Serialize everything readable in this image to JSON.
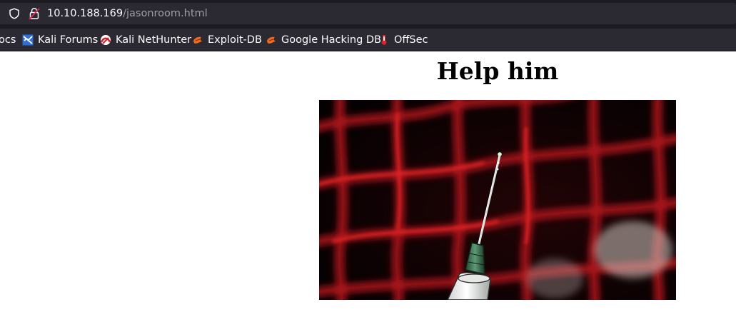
{
  "browser": {
    "url_host": "10.10.188.169",
    "url_path": "/jasonroom.html"
  },
  "bookmarks": [
    {
      "label": "ocs",
      "icon": "kali-docs-icon"
    },
    {
      "label": "Kali Forums",
      "icon": "kali-forums-icon"
    },
    {
      "label": "Kali NetHunter",
      "icon": "kali-nethunter-icon"
    },
    {
      "label": "Exploit-DB",
      "icon": "exploit-db-icon"
    },
    {
      "label": "Google Hacking DB",
      "icon": "exploit-db-icon"
    },
    {
      "label": "OffSec",
      "icon": "offsec-icon"
    }
  ],
  "page": {
    "title": "Help him",
    "image": "syringe-in-front-of-red-fence"
  },
  "colors": {
    "chrome_bg": "#2b2a33",
    "chrome_dark": "#1c1b22",
    "fence_red": "#c0141a"
  }
}
